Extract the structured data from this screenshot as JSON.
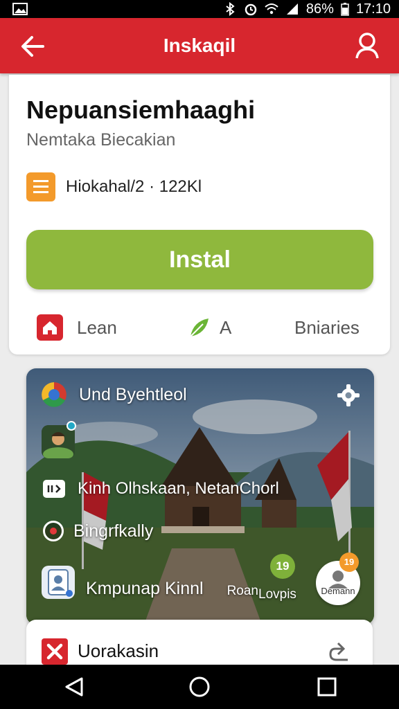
{
  "status_bar": {
    "battery": "86%",
    "time": "17:10"
  },
  "app_bar": {
    "title": "Inskaqil"
  },
  "app": {
    "name": "Nepuansiemhaaghi",
    "subtitle": "Nemtaka Biecakian",
    "meta": "Hiokahal/2 · 122Kl",
    "install_label": "Instal"
  },
  "tabs": [
    {
      "label": "Lean",
      "icon": "house-icon"
    },
    {
      "label": "A",
      "icon": "leaf-icon"
    },
    {
      "label": "Bniaries",
      "icon": "profile-icon"
    }
  ],
  "feature": {
    "title": "Und Byehtleol",
    "location": "Kinh Olhskaan, NetanChorl",
    "row_label": "Bingrfkally",
    "profile_name": "Kmpunap Kinnl",
    "small_label": "Roan",
    "green_badge": "19",
    "secondary_label": "Lovpis",
    "fab_label": "Demann",
    "fab_badge": "19"
  },
  "bottom_card": {
    "label": "Uorakasin"
  },
  "colors": {
    "brand_red": "#d7262e",
    "install_green": "#8fb83d",
    "accent_orange": "#f39a2b"
  }
}
